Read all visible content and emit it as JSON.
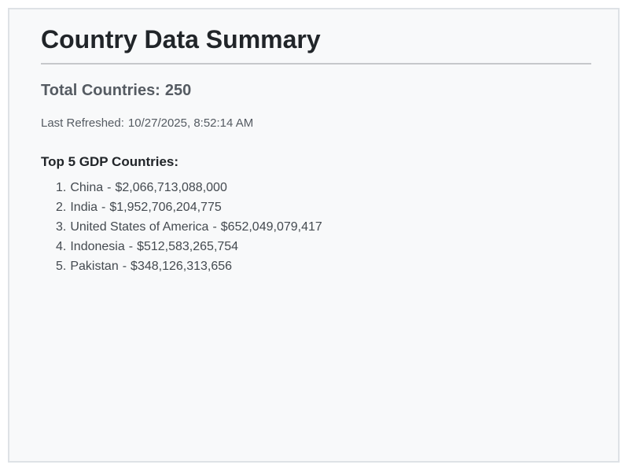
{
  "page": {
    "title": "Country Data Summary",
    "total_label": "Total Countries:",
    "total_value": "250",
    "refreshed_label": "Last Refreshed:",
    "refreshed_value": "10/27/2025, 8:52:14 AM",
    "top_heading": "Top 5 GDP Countries:"
  },
  "top_countries": [
    {
      "rank": "1.",
      "name": "China",
      "gdp": "$2,066,713,088,000"
    },
    {
      "rank": "2.",
      "name": "India",
      "gdp": "$1,952,706,204,775"
    },
    {
      "rank": "3.",
      "name": "United States of America",
      "gdp": "$652,049,079,417"
    },
    {
      "rank": "4.",
      "name": "Indonesia",
      "gdp": "$512,583,265,754"
    },
    {
      "rank": "5.",
      "name": "Pakistan",
      "gdp": "$348,126,313,656"
    }
  ],
  "colors": {
    "background": "#f8f9fa",
    "border": "#dee2e6",
    "title": "#212529",
    "muted_text": "#555b62"
  }
}
